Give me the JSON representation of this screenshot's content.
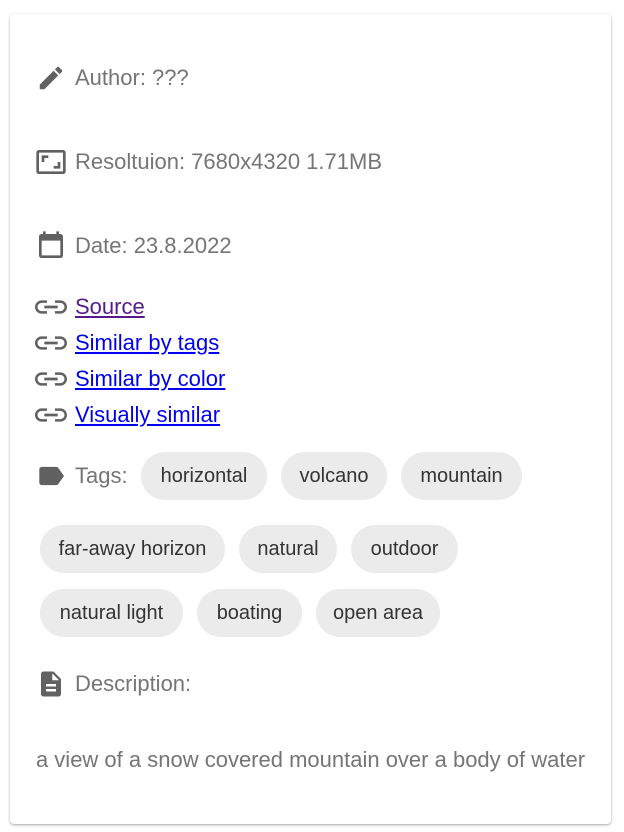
{
  "info": {
    "author": "Author: ???",
    "resolution": "Resoltuion: 7680x4320 1.71MB",
    "date": "Date: 23.8.2022"
  },
  "links": [
    {
      "label": "Source"
    },
    {
      "label": "Similar by tags"
    },
    {
      "label": "Similar by color"
    },
    {
      "label": "Visually similar"
    }
  ],
  "tags": {
    "label": "Tags:",
    "items": [
      "horizontal",
      "volcano",
      "mountain",
      "far-away horizon",
      "natural",
      "outdoor",
      "natural light",
      "boating",
      "open area"
    ]
  },
  "description": {
    "label": "Description:",
    "text": "a view of a snow covered mountain over a body of water"
  },
  "colors": {
    "icon": "#616161",
    "text": "#757575",
    "chip_bg": "#ebebeb",
    "link": "#0000ee",
    "link_visited": "#551a8b"
  }
}
